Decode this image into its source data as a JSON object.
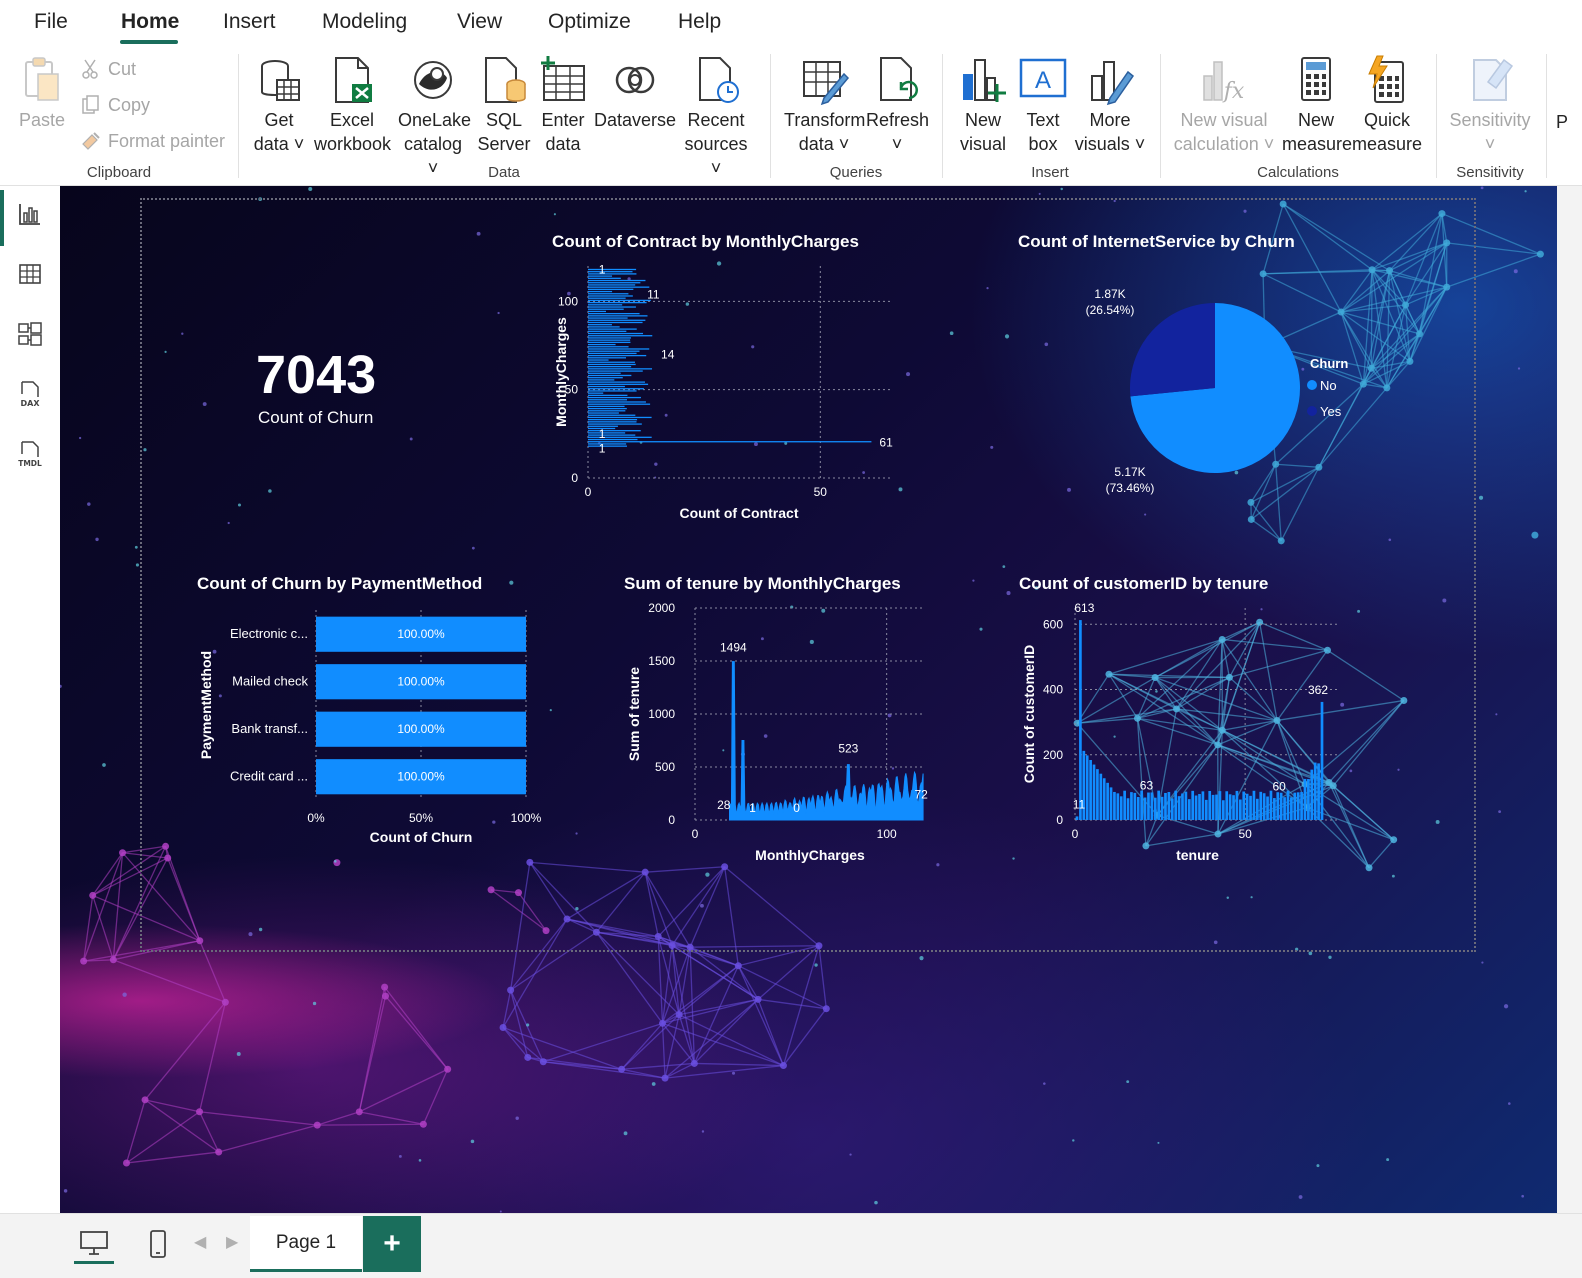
{
  "menu": {
    "items": [
      "File",
      "Home",
      "Insert",
      "Modeling",
      "View",
      "Optimize",
      "Help"
    ],
    "active": "Home"
  },
  "ribbon": {
    "clipboard": {
      "paste": "Paste",
      "cut": "Cut",
      "copy": "Copy",
      "format_painter": "Format painter",
      "group_label": "Clipboard"
    },
    "data": {
      "get_data": [
        "Get",
        "data"
      ],
      "excel": [
        "Excel",
        "workbook"
      ],
      "onelake": [
        "OneLake",
        "catalog"
      ],
      "sql": [
        "SQL",
        "Server"
      ],
      "enter": [
        "Enter",
        "data"
      ],
      "dataverse": [
        "Dataverse",
        ""
      ],
      "recent": [
        "Recent",
        "sources"
      ],
      "group_label": "Data"
    },
    "queries": {
      "transform": [
        "Transform",
        "data"
      ],
      "refresh": [
        "Refresh",
        ""
      ],
      "group_label": "Queries"
    },
    "insert": {
      "new_visual": [
        "New",
        "visual"
      ],
      "text_box": [
        "Text",
        "box"
      ],
      "more_visuals": [
        "More",
        "visuals"
      ],
      "group_label": "Insert"
    },
    "calculations": {
      "new_visual_calc": [
        "New visual",
        "calculation"
      ],
      "new_measure": [
        "New",
        "measure"
      ],
      "quick_measure": [
        "Quick",
        "measure"
      ],
      "group_label": "Calculations"
    },
    "sensitivity": {
      "label": "Sensitivity",
      "group_label": "Sensitivity"
    },
    "truncated": "P"
  },
  "rail": {
    "icons": [
      "report-view-icon",
      "table-view-icon",
      "model-view-icon",
      "dax-query-icon",
      "tmdl-view-icon"
    ],
    "dax_text": "DAX",
    "tmdl_text": "TMDL"
  },
  "card": {
    "value": "7043",
    "label": "Count of Churn"
  },
  "chart_data": [
    {
      "type": "bar",
      "orientation": "horizontal",
      "title": "Count of Contract by MonthlyCharges",
      "xlabel": "Count of Contract",
      "ylabel": "MonthlyCharges",
      "xlim": [
        0,
        65
      ],
      "ylim": [
        0,
        120
      ],
      "x_ticks": [
        "0",
        "50"
      ],
      "y_ticks": [
        "0",
        "50",
        "100"
      ],
      "data_labels": [
        {
          "y": 118,
          "value": "1"
        },
        {
          "y": 104,
          "value": "11"
        },
        {
          "y": 70,
          "value": "14"
        },
        {
          "y": 25,
          "value": "1"
        },
        {
          "y": 20,
          "value": "1"
        },
        {
          "y": 20,
          "value": "61"
        }
      ],
      "grid": true
    },
    {
      "type": "pie",
      "title": "Count of InternetService by Churn",
      "legend_title": "Churn",
      "legend_position": "right",
      "slices": [
        {
          "name": "No",
          "value": 5170,
          "label": "5.17K",
          "pct_label": "(73.46%)",
          "color": "#118dff"
        },
        {
          "name": "Yes",
          "value": 1870,
          "label": "1.87K",
          "pct_label": "(26.54%)",
          "color": "#12239e"
        }
      ]
    },
    {
      "type": "bar",
      "orientation": "horizontal",
      "stacked_percent": true,
      "title": "Count of Churn by PaymentMethod",
      "xlabel": "Count of Churn",
      "ylabel": "PaymentMethod",
      "categories": [
        "Electronic c...",
        "Mailed check",
        "Bank transf...",
        "Credit card ..."
      ],
      "values": [
        100,
        100,
        100,
        100
      ],
      "value_labels": [
        "100.00%",
        "100.00%",
        "100.00%",
        "100.00%"
      ],
      "x_ticks": [
        "0%",
        "50%",
        "100%"
      ],
      "color": "#118dff"
    },
    {
      "type": "area",
      "title": "Sum of tenure by MonthlyCharges",
      "xlabel": "MonthlyCharges",
      "ylabel": "Sum of tenure",
      "xlim": [
        0,
        120
      ],
      "ylim": [
        0,
        2000
      ],
      "x_ticks": [
        "0",
        "100"
      ],
      "y_ticks": [
        "0",
        "500",
        "1000",
        "1500",
        "2000"
      ],
      "data_labels": [
        {
          "x": 20,
          "value": "1494"
        },
        {
          "x": 18,
          "value": "28"
        },
        {
          "x": 30,
          "value": "1"
        },
        {
          "x": 53,
          "value": "0"
        },
        {
          "x": 80,
          "value": "523"
        },
        {
          "x": 118,
          "value": "72"
        }
      ],
      "color": "#118dff"
    },
    {
      "type": "bar",
      "title": "Count of customerID by tenure",
      "xlabel": "tenure",
      "ylabel": "Count of customerID",
      "xlim": [
        0,
        72
      ],
      "ylim": [
        0,
        650
      ],
      "x_ticks": [
        "0",
        "50"
      ],
      "y_ticks": [
        "0",
        "200",
        "400",
        "600"
      ],
      "data_labels": [
        {
          "x": 1,
          "value": "613"
        },
        {
          "x": 0,
          "value": "11"
        },
        {
          "x": 21,
          "value": "63"
        },
        {
          "x": 60,
          "value": "60"
        },
        {
          "x": 72,
          "value": "362"
        }
      ],
      "color": "#118dff"
    }
  ],
  "bottom": {
    "page_tab": "Page 1",
    "add_page": "+"
  }
}
